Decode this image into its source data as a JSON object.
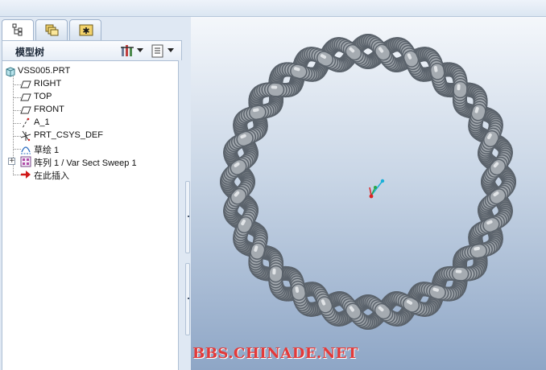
{
  "tabs": [
    {
      "icon": "model-tree-icon",
      "active": true
    },
    {
      "icon": "folder-browser-icon",
      "active": false
    },
    {
      "icon": "favorites-icon",
      "active": false
    }
  ],
  "tree_header": {
    "title": "模型树",
    "settings_icon": "tree-settings-icon",
    "show_icon": "tree-show-icon"
  },
  "tree": {
    "root": {
      "label": "VSS005.PRT",
      "icon": "part-icon"
    },
    "items": [
      {
        "label": "RIGHT",
        "icon": "datum-plane-icon"
      },
      {
        "label": "TOP",
        "icon": "datum-plane-icon"
      },
      {
        "label": "FRONT",
        "icon": "datum-plane-icon"
      },
      {
        "label": "A_1",
        "icon": "datum-axis-icon"
      },
      {
        "label": "PRT_CSYS_DEF",
        "icon": "coordinate-system-icon"
      },
      {
        "label": "草绘 1",
        "icon": "sketch-icon"
      },
      {
        "label": "阵列 1 / Var Sect Sweep 1",
        "icon": "pattern-icon",
        "expandable": true
      },
      {
        "label": "在此插入",
        "icon": "insert-here-arrow-icon"
      }
    ]
  },
  "viewport": {
    "watermark": "BBS.CHINADE.NET",
    "model": "twisted-ring",
    "colors": {
      "model": "#9aa1a8",
      "watermark": "#e23a3a",
      "bg_top": "#f4f7fb",
      "bg_bottom": "#8ea6c6"
    }
  }
}
